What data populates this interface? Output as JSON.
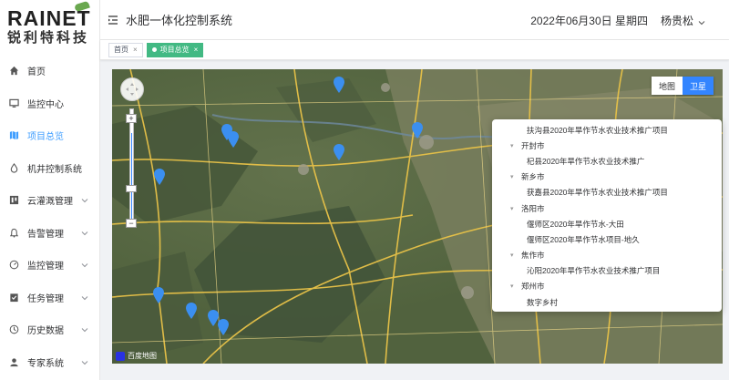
{
  "brand": {
    "logo_en": "RAINET",
    "logo_cn": "锐利特科技"
  },
  "sidebar": {
    "items": [
      {
        "label": "首页",
        "icon": "home-icon",
        "active": false,
        "expandable": false
      },
      {
        "label": "监控中心",
        "icon": "monitor-icon",
        "active": false,
        "expandable": false
      },
      {
        "label": "项目总览",
        "icon": "map-icon",
        "active": true,
        "expandable": false
      },
      {
        "label": "机井控制系统",
        "icon": "water-drop-icon",
        "active": false,
        "expandable": false
      },
      {
        "label": "云灌溉管理",
        "icon": "board-icon",
        "active": false,
        "expandable": true
      },
      {
        "label": "告警管理",
        "icon": "bell-icon",
        "active": false,
        "expandable": true
      },
      {
        "label": "监控管理",
        "icon": "gauge-icon",
        "active": false,
        "expandable": true
      },
      {
        "label": "任务管理",
        "icon": "task-icon",
        "active": false,
        "expandable": true
      },
      {
        "label": "历史数据",
        "icon": "clock-icon",
        "active": false,
        "expandable": true
      },
      {
        "label": "专家系统",
        "icon": "expert-icon",
        "active": false,
        "expandable": true
      }
    ]
  },
  "header": {
    "title": "水肥一体化控制系统",
    "date": "2022年06月30日 星期四",
    "user": "杨贵松"
  },
  "tags": [
    {
      "label": "首页",
      "active": false,
      "close": "×"
    },
    {
      "label": "项目总览",
      "active": true,
      "close": "×"
    }
  ],
  "map": {
    "type_buttons": {
      "map": "地图",
      "satellite": "卫星"
    },
    "selected_type": "卫星",
    "zoom_controls": {
      "plus": "+",
      "minus": "−"
    },
    "tree": [
      {
        "kind": "project",
        "label": "扶沟县2020年旱作节水农业技术推广项目"
      },
      {
        "kind": "city",
        "label": "开封市"
      },
      {
        "kind": "project",
        "label": "杞县2020年旱作节水农业技术推广"
      },
      {
        "kind": "city",
        "label": "新乡市"
      },
      {
        "kind": "project",
        "label": "获嘉县2020年旱作节水农业技术推广项目"
      },
      {
        "kind": "city",
        "label": "洛阳市"
      },
      {
        "kind": "project",
        "label": "偃师区2020年旱作节水-大田"
      },
      {
        "kind": "project",
        "label": "偃师区2020年旱作节水项目-地久"
      },
      {
        "kind": "city",
        "label": "焦作市"
      },
      {
        "kind": "project",
        "label": "沁阳2020年旱作节水农业技术推广项目"
      },
      {
        "kind": "city",
        "label": "郑州市"
      },
      {
        "kind": "project",
        "label": "数字乡村"
      }
    ],
    "pin_color": "#3b8ff0",
    "attribution": "百度地图"
  }
}
